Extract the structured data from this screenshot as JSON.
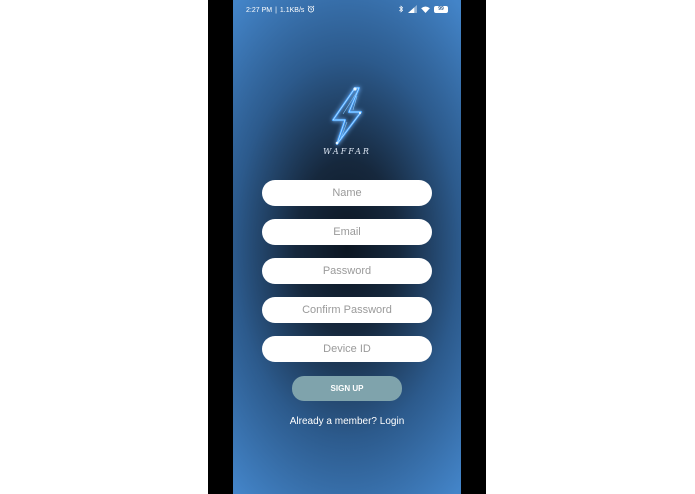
{
  "status_bar": {
    "time": "2:27 PM",
    "separator": "|",
    "speed": "1.1KB/s",
    "left_icon": "alarm-icon",
    "right_icons": [
      "bluetooth-icon",
      "signal-icon",
      "wifi-icon",
      "battery-icon"
    ],
    "battery": "99"
  },
  "logo": {
    "icon": "lightning-bolt-icon",
    "brand": "WAFFAR",
    "color": "#4aa8ff"
  },
  "form": {
    "name_placeholder": "Name",
    "email_placeholder": "Email",
    "password_placeholder": "Password",
    "confirm_password_placeholder": "Confirm Password",
    "device_id_placeholder": "Device ID",
    "signup_label": "SIGN UP"
  },
  "footer": {
    "prompt": "Already a member?",
    "login_label": "Login"
  },
  "colors": {
    "background_center": "#0c1622",
    "background_edge": "#4384c8",
    "button": "#7fa3ac",
    "field": "#ffffff"
  }
}
